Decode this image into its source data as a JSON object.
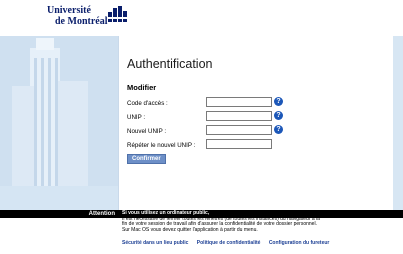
{
  "logo": {
    "line1": "Université",
    "line2": "de Montréal"
  },
  "colors": {
    "brand_navy": "#0a1e6b",
    "band_blue": "#d7e6f3",
    "help_blue": "#1c57b8",
    "button": "#6d8fc7"
  },
  "page": {
    "title": "Authentification",
    "subtitle": "Modifier"
  },
  "form": {
    "fields": [
      {
        "label": "Code d'accès :",
        "value": "",
        "help": "?"
      },
      {
        "label": "UNIP :",
        "value": "",
        "help": "?"
      },
      {
        "label": "Nouvel UNIP :",
        "value": "",
        "help": "?"
      },
      {
        "label": "Répéter le nouvel UNIP :",
        "value": ""
      }
    ],
    "submit_label": "Confirmer"
  },
  "footer": {
    "attention_label": "Attention",
    "notice_heading": "Si vous utilisez un ordinateur public,",
    "notice_lines": [
      "Il est nécessaire de fermer toutes les fenêtres (de toutes les instances) du navigateur à la",
      "fin de votre session de travail afin d'assurer la confidentialité de votre dossier personnel.",
      "Sur Mac OS vous devez quitter l'application à partir du menu."
    ],
    "links": [
      "Sécurité dans un lieu public",
      "Politique de confidentialité",
      "Configuration du fureteur"
    ]
  }
}
